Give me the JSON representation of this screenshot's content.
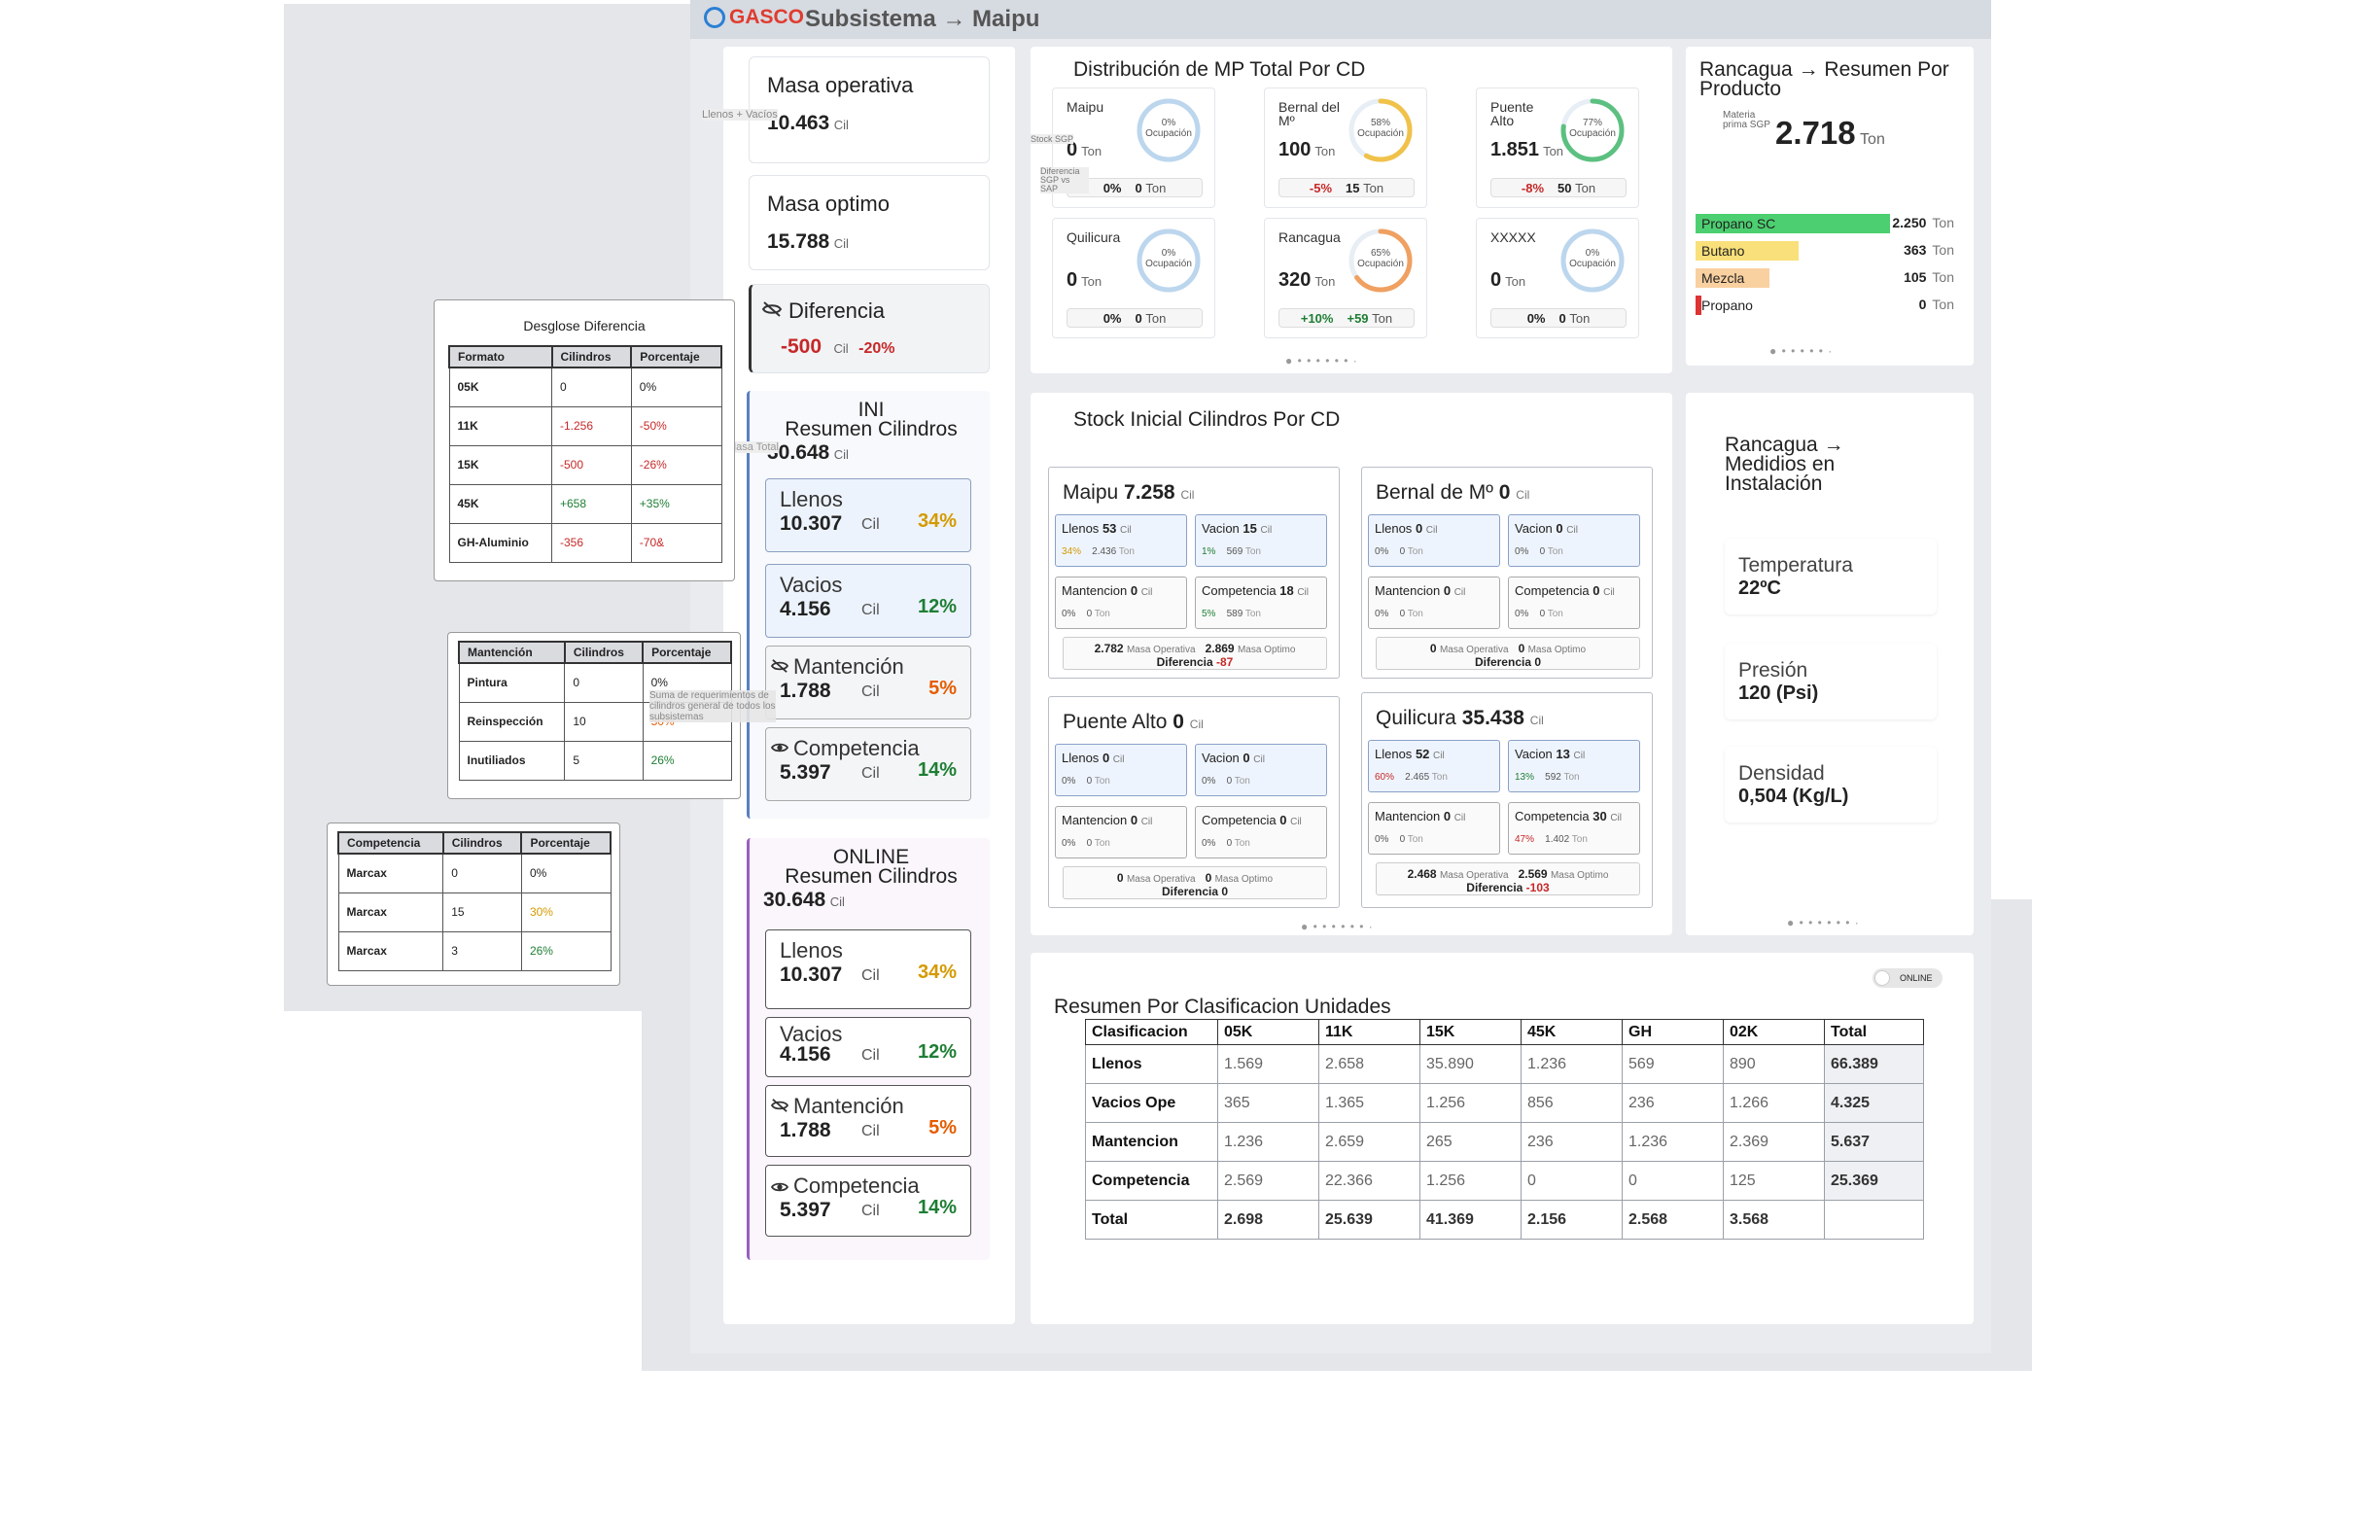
{
  "header": {
    "brand": "GASCO",
    "title": "Subsistema → Maipu"
  },
  "kpis": {
    "masa_operativa": {
      "label": "Masa operativa",
      "value": "10.463",
      "unit": "Cil",
      "hint": "Llenos + Vacíos"
    },
    "masa_optimo": {
      "label": "Masa optimo",
      "value": "15.788",
      "unit": "Cil"
    },
    "diferencia": {
      "label": "Diferencia",
      "value": "-500",
      "unit": "Cil",
      "pct": "-20%"
    }
  },
  "ini": {
    "title1": "INI",
    "title2": "Resumen Cilindros",
    "total": "30.648",
    "unit": "Cil",
    "hint": "Masa Total",
    "items": [
      {
        "name": "Llenos",
        "value": "10.307",
        "unit": "Cil",
        "pct": "34%"
      },
      {
        "name": "Vacios",
        "value": "4.156",
        "unit": "Cil",
        "pct": "12%"
      },
      {
        "name": "Mantención",
        "value": "1.788",
        "unit": "Cil",
        "pct": "5%"
      },
      {
        "name": "Competencia",
        "value": "5.397",
        "unit": "Cil",
        "pct": "14%"
      }
    ]
  },
  "online": {
    "title1": "ONLINE",
    "title2": "Resumen Cilindros",
    "total": "30.648",
    "unit": "Cil",
    "items": [
      {
        "name": "Llenos",
        "value": "10.307",
        "unit": "Cil",
        "pct": "34%"
      },
      {
        "name": "Vacios",
        "value": "4.156",
        "unit": "Cil",
        "pct": "12%"
      },
      {
        "name": "Mantención",
        "value": "1.788",
        "unit": "Cil",
        "pct": "5%"
      },
      {
        "name": "Competencia",
        "value": "5.397",
        "unit": "Cil",
        "pct": "14%"
      }
    ]
  },
  "desglose": {
    "title": "Desglose Diferencia",
    "headers": [
      "Formato",
      "Cilindros",
      "Porcentaje"
    ],
    "rows": [
      [
        "05K",
        "0",
        "0%"
      ],
      [
        "11K",
        "-1.256",
        "-50%"
      ],
      [
        "15K",
        "-500",
        "-26%"
      ],
      [
        "45K",
        "+658",
        "+35%"
      ],
      [
        "GH-Aluminio",
        "-356",
        "-70&"
      ]
    ]
  },
  "mantencion_tbl": {
    "headers": [
      "Mantención",
      "Cilindros",
      "Porcentaje"
    ],
    "rows": [
      [
        "Pintura",
        "0",
        "0%"
      ],
      [
        "Reinspección",
        "10",
        "50%"
      ],
      [
        "Inutiliados",
        "5",
        "26%"
      ]
    ],
    "tooltip": "Suma de requerimientos de cilindros general de todos los subsistemas"
  },
  "competencia_tbl": {
    "headers": [
      "Competencia",
      "Cilindros",
      "Porcentaje"
    ],
    "rows": [
      [
        "Marcax",
        "0",
        "0%"
      ],
      [
        "Marcax",
        "15",
        "30%"
      ],
      [
        "Marcax",
        "3",
        "26%"
      ]
    ]
  },
  "dist": {
    "title": "Distribución de MP Total Por CD",
    "stock_hint": "Stock SGP",
    "diff_hint": "Diferencia SGP vs SAP",
    "cards": [
      {
        "name": "Maipu",
        "value": "0",
        "unit": "Ton",
        "occ": 0,
        "occ_label": "0%",
        "occ_text": "Ocupación",
        "diff_pct": "0%",
        "diff_ton": "0",
        "ring": "#bcd6ee"
      },
      {
        "name": "Bernal del Mº",
        "value": "100",
        "unit": "Ton",
        "occ": 58,
        "occ_label": "58%",
        "occ_text": "Ocupación",
        "diff_pct": "-5%",
        "diff_ton": "15",
        "ring": "#f0c24a"
      },
      {
        "name": "Puente Alto",
        "value": "1.851",
        "unit": "Ton",
        "occ": 77,
        "occ_label": "77%",
        "occ_text": "Ocupación",
        "diff_pct": "-8%",
        "diff_ton": "50",
        "ring": "#5cc080"
      },
      {
        "name": "Quilicura",
        "value": "0",
        "unit": "Ton",
        "occ": 0,
        "occ_label": "0%",
        "occ_text": "Ocupación",
        "diff_pct": "0%",
        "diff_ton": "0",
        "ring": "#bcd6ee"
      },
      {
        "name": "Rancagua",
        "value": "320",
        "unit": "Ton",
        "occ": 65,
        "occ_label": "65%",
        "occ_text": "Ocupación",
        "diff_pct": "+10%",
        "diff_ton": "+59",
        "ring": "#f0a060"
      },
      {
        "name": "XXXXX",
        "value": "0",
        "unit": "Ton",
        "occ": 0,
        "occ_label": "0%",
        "occ_text": "Ocupación",
        "diff_pct": "0%",
        "diff_ton": "0",
        "ring": "#bcd6ee"
      }
    ],
    "ton": "Ton"
  },
  "producto": {
    "title": "Rancagua → Resumen Por Producto",
    "sub_label": "Materia prima SGP",
    "total": "2.718",
    "unit": "Ton",
    "items": [
      {
        "name": "Propano SC",
        "value": "2.250",
        "share": 1.0,
        "color": "#4ccf70"
      },
      {
        "name": "Butano",
        "value": "363",
        "share": 0.53,
        "color": "#f9e07a"
      },
      {
        "name": "Mezcla",
        "value": "105",
        "share": 0.38,
        "color": "#f9d0a0"
      },
      {
        "name": "Propano",
        "value": "0",
        "share": 0.03,
        "color": "#d33"
      }
    ],
    "unit_each": "Ton"
  },
  "stock": {
    "title": "Stock Inicial Cilindros Por CD",
    "boxes": [
      {
        "name": "Maipu",
        "value": "7.258",
        "unit": "Cil",
        "cells": [
          [
            "Llenos",
            "53",
            "34%",
            "2.436"
          ],
          [
            "Vacion",
            "15",
            "1%",
            "569"
          ],
          [
            "Mantencion",
            "0",
            "0%",
            "0"
          ],
          [
            "Competencia",
            "18",
            "5%",
            "589"
          ]
        ],
        "mo": "2.782",
        "mop": "2.869",
        "dif": "-87"
      },
      {
        "name": "Bernal de Mº",
        "value": "0",
        "unit": "Cil",
        "cells": [
          [
            "Llenos",
            "0",
            "0%",
            "0"
          ],
          [
            "Vacion",
            "0",
            "0%",
            "0"
          ],
          [
            "Mantencion",
            "0",
            "0%",
            "0"
          ],
          [
            "Competencia",
            "0",
            "0%",
            "0"
          ]
        ],
        "mo": "0",
        "mop": "0",
        "dif": "0"
      },
      {
        "name": "Puente Alto",
        "value": "0",
        "unit": "Cil",
        "cells": [
          [
            "Llenos",
            "0",
            "0%",
            "0"
          ],
          [
            "Vacion",
            "0",
            "0%",
            "0"
          ],
          [
            "Mantencion",
            "0",
            "0%",
            "0"
          ],
          [
            "Competencia",
            "0",
            "0%",
            "0"
          ]
        ],
        "mo": "0",
        "mop": "0",
        "dif": "0"
      },
      {
        "name": "Quilicura",
        "value": "35.438",
        "unit": "Cil",
        "cells": [
          [
            "Llenos",
            "52",
            "60%",
            "2.465"
          ],
          [
            "Vacion",
            "13",
            "13%",
            "592"
          ],
          [
            "Mantencion",
            "0",
            "0%",
            "0"
          ],
          [
            "Competencia",
            "30",
            "47%",
            "1.402"
          ]
        ],
        "mo": "2.468",
        "mop": "2.569",
        "dif": "-103"
      }
    ],
    "cil": "Cil",
    "ton": "Ton",
    "mo_label": "Masa Operativa",
    "mop_label": "Masa Optimo",
    "dif_label": "Diferencia"
  },
  "sensores": {
    "title": "Rancagua → Medidios en Instalación",
    "items": [
      {
        "label": "Temperatura",
        "value": "22ºC"
      },
      {
        "label": "Presión",
        "value": "120 (Psi)"
      },
      {
        "label": "Densidad",
        "value": "0,504 (Kg/L)"
      }
    ]
  },
  "clasif": {
    "title": "Resumen Por Clasificacion Unidades",
    "toggle": "ONLINE",
    "headers": [
      "Clasificacion",
      "05K",
      "11K",
      "15K",
      "45K",
      "GH",
      "02K",
      "Total"
    ],
    "rows": [
      [
        "Llenos",
        "1.569",
        "2.658",
        "35.890",
        "1.236",
        "569",
        "890",
        "66.389"
      ],
      [
        "Vacios Ope",
        "365",
        "1.365",
        "1.256",
        "856",
        "236",
        "1.266",
        "4.325"
      ],
      [
        "Mantencion",
        "1.236",
        "2.659",
        "265",
        "236",
        "1.236",
        "2.369",
        "5.637"
      ],
      [
        "Competencia",
        "2.569",
        "22.366",
        "1.256",
        "0",
        "0",
        "125",
        "25.369"
      ],
      [
        "Total",
        "2.698",
        "25.639",
        "41.369",
        "2.156",
        "2.568",
        "3.568",
        ""
      ]
    ]
  }
}
